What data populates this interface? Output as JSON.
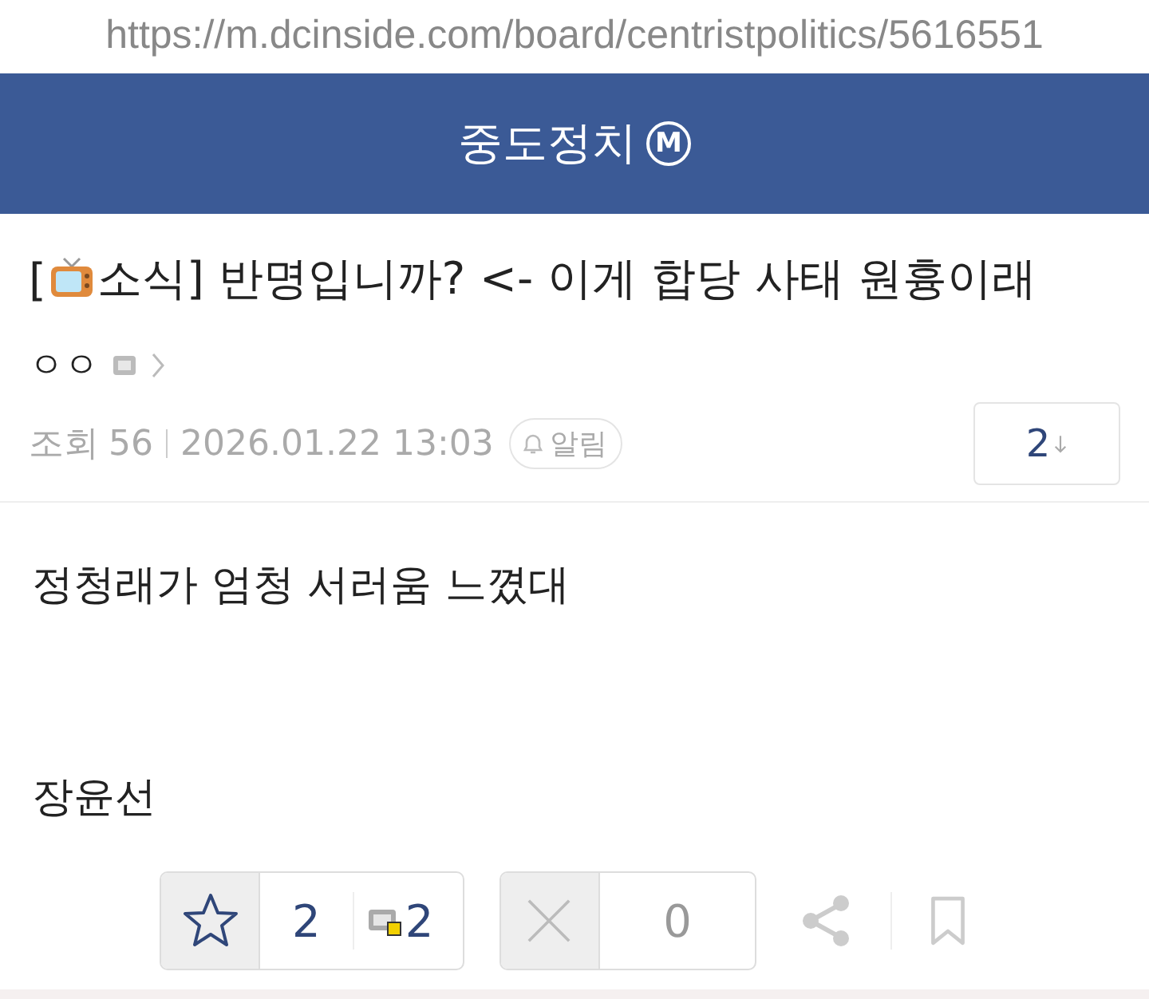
{
  "url": "https://m.dcinside.com/board/centristpolitics/5616551",
  "header": {
    "title": "중도정치",
    "badge": "M"
  },
  "post": {
    "title_prefix": "[",
    "title": "소식] 반명입니까? <- 이게 합당 사태 원흉이래",
    "author": "ㅇㅇ",
    "views_label": "조회",
    "views": "56",
    "date": "2026.01.22 13:03",
    "alarm": "알림",
    "comments": "2",
    "body": [
      "정청래가 엄청 서러움 느꼈대",
      "장윤선"
    ]
  },
  "votes": {
    "up": "2",
    "up_fixed": "2",
    "down": "0"
  }
}
